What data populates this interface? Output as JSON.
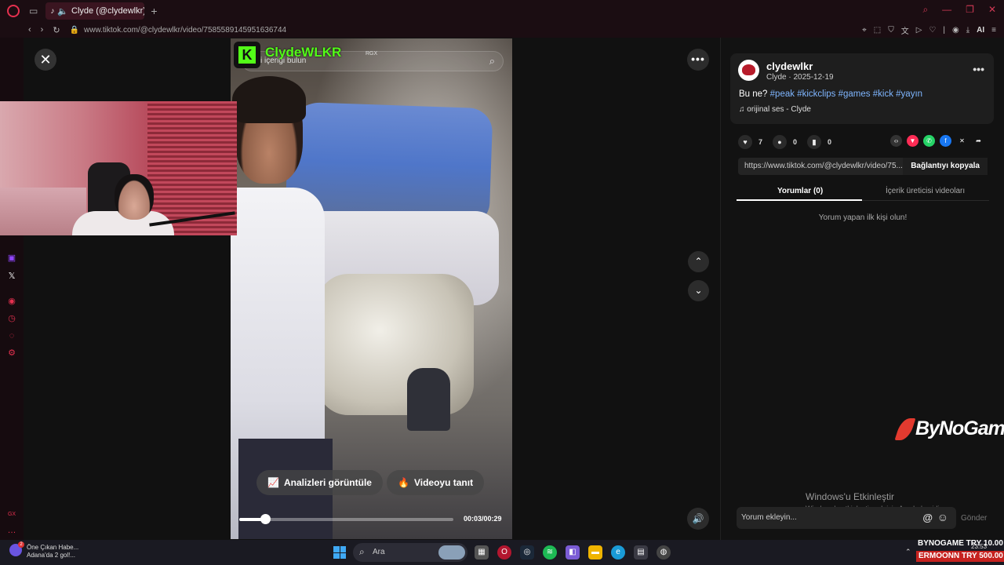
{
  "browser": {
    "tab_title": "Clyde (@clydewlkr) | T",
    "url": "www.tiktok.com/@clydewlkr/video/7585589145951636744",
    "ai_label": "AI"
  },
  "video": {
    "channel_name": "ClydeWLKR",
    "badge": "RGX",
    "search_placeholder": "İlgili içeriği bulun",
    "analytics_label": "Analizleri görüntüle",
    "promote_label": "Videoyu tanıt",
    "time": "00:03/00:29",
    "progress": 0.12
  },
  "post": {
    "username": "clydewlkr",
    "meta": "Clyde · 2025-12-19",
    "caption_text": "Bu ne?",
    "hashtags": [
      "#peak",
      "#kickclips",
      "#games",
      "#kick",
      "#yayın"
    ],
    "sound": "orijinal ses - Clyde",
    "likes": "7",
    "comments": "0",
    "saves": "0"
  },
  "link": {
    "url": "https://www.tiktok.com/@clydewlkr/video/75...",
    "copy_label": "Bağlantıyı kopyala"
  },
  "tabs": {
    "comments": "Yorumlar (0)",
    "creator_videos": "İçerik üreticisi videoları"
  },
  "empty_comments": "Yorum yapan ilk kişi olun!",
  "comment_box": {
    "placeholder": "Yorum ekleyin...",
    "send": "Gönder"
  },
  "watermark": "ByNoGame",
  "activation": {
    "title": "Windows'u Etkinleştir",
    "subtitle": "Windows'u etkinleştirmek için Ayarlar'a gidin."
  },
  "taskbar": {
    "news_title": "Öne Çıkan Habe...",
    "news_sub": "Adana'da 2 gol!...",
    "search": "Ara",
    "clock": "23:53"
  },
  "overlay_prices": {
    "line1": "BYNOGAME  TRY 10.00",
    "line2": "ERMOONN  TRY 500.00"
  },
  "colors": {
    "kick_green": "#53fc18",
    "hashtag": "#7fb6ff",
    "opera_red": "#e5304f"
  }
}
